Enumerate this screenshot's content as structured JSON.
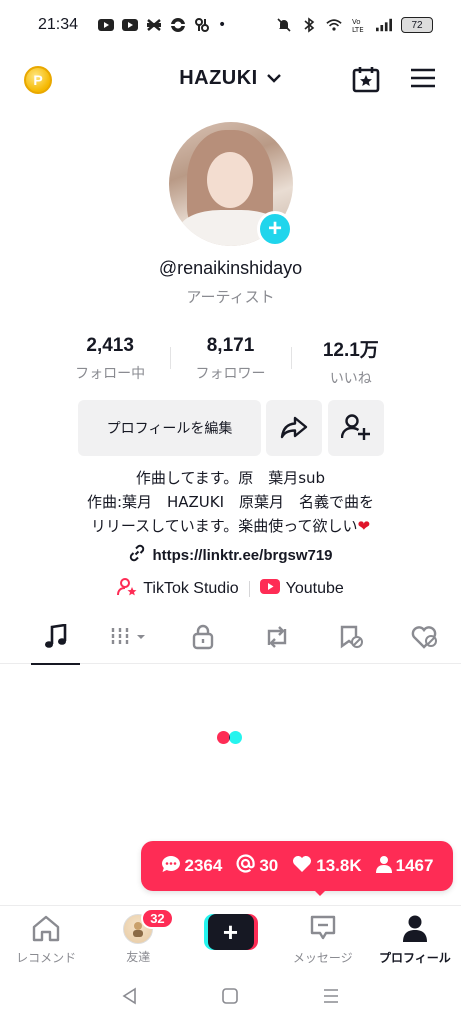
{
  "status_bar": {
    "time": "21:34",
    "dot": "•",
    "battery": "72"
  },
  "header": {
    "account_name": "HAZUKI",
    "coin_label": "P"
  },
  "profile": {
    "username": "@renaikinshidayo",
    "category": "アーティスト",
    "avatar_plus": "+"
  },
  "stats": [
    {
      "value": "2,413",
      "label": "フォロー中"
    },
    {
      "value": "8,171",
      "label": "フォロワー"
    },
    {
      "value": "12.1万",
      "label": "いいね"
    }
  ],
  "actions": {
    "edit_profile": "プロフィールを編集"
  },
  "bio": {
    "line1": "作曲してます。原　葉月sub",
    "line2": "作曲:葉月　HAZUKI　原葉月　名義で曲を",
    "line3": "リリースしています。楽曲使って欲しい",
    "line3_emoji": "❤"
  },
  "link": "https://linktr.ee/brgsw719",
  "shortcuts": {
    "studio": "TikTok Studio",
    "youtube": "Youtube"
  },
  "tabs": [
    {
      "icon": "music-note-icon"
    },
    {
      "icon": "grid-filter-icon"
    },
    {
      "icon": "lock-icon"
    },
    {
      "icon": "repost-icon"
    },
    {
      "icon": "saved-icon"
    },
    {
      "icon": "liked-hidden-icon"
    }
  ],
  "notifications": {
    "comments": "2364",
    "mentions": "30",
    "likes": "13.8K",
    "followers": "1467"
  },
  "bottom_nav": {
    "home": "レコメンド",
    "friends": "友達",
    "friends_badge": "32",
    "create": "+",
    "inbox": "メッセージ",
    "profile": "プロフィール"
  },
  "colors": {
    "accent_red": "#fe2c55",
    "accent_cyan": "#25f4ee",
    "plus_blue": "#20d5ec"
  }
}
